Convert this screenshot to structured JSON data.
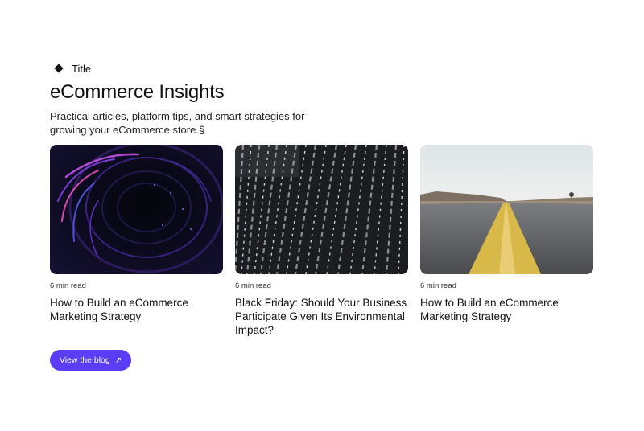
{
  "header": {
    "eyebrow": "Title",
    "title": "eCommerce Insights",
    "subtitle": "Practical articles, platform tips, and smart strategies for growing your eCommerce store.§"
  },
  "cards": [
    {
      "read_time": "6 min read",
      "title": "How to Build an eCommerce Marketing Strategy",
      "image": "dark-tunnel-lights"
    },
    {
      "read_time": "6 min read",
      "title": "Black Friday: Should Your Business Participate Given Its Environmental Impact?",
      "image": "metal-pattern-facade"
    },
    {
      "read_time": "6 min read",
      "title": "How to Build an eCommerce Marketing Strategy",
      "image": "desert-road"
    }
  ],
  "cta": {
    "label": "View the blog",
    "icon": "arrow-up-right-icon",
    "color": "#5a3df5"
  }
}
